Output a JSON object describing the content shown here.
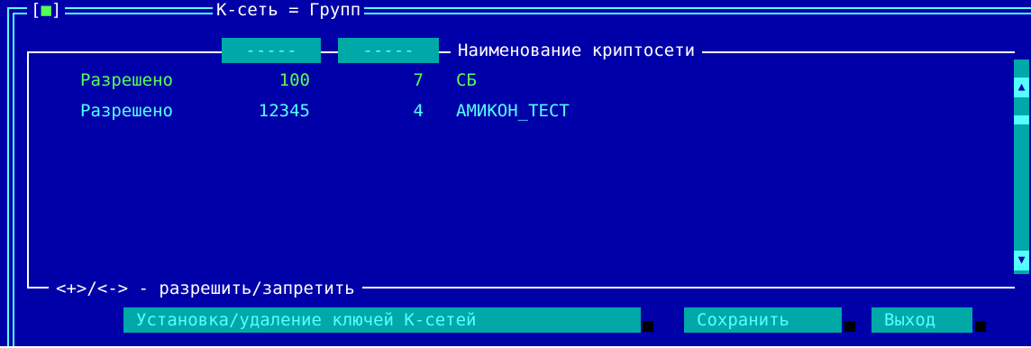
{
  "window": {
    "close_box": "[■]",
    "title": "К-сеть = Групп"
  },
  "columns": {
    "status_placeholder": "-----",
    "number_placeholder": "-----",
    "name_header": "Наименование криптосети"
  },
  "rows": [
    {
      "status": "Разрешено",
      "number": "100",
      "group": "7",
      "name": "СБ"
    },
    {
      "status": "Разрешено",
      "number": "12345",
      "group": "4",
      "name": "АМИКОН_ТЕСТ"
    }
  ],
  "hint": "<+>/<-> - разрешить/запретить",
  "buttons": {
    "keys": "Установка/удаление ключей К-сетей",
    "save": "Сохранить",
    "exit": "Выход"
  },
  "colors": {
    "background": "#0000a8",
    "frame": "#55ffff",
    "selected_row": "#55ff55",
    "button": "#00a8a8"
  }
}
